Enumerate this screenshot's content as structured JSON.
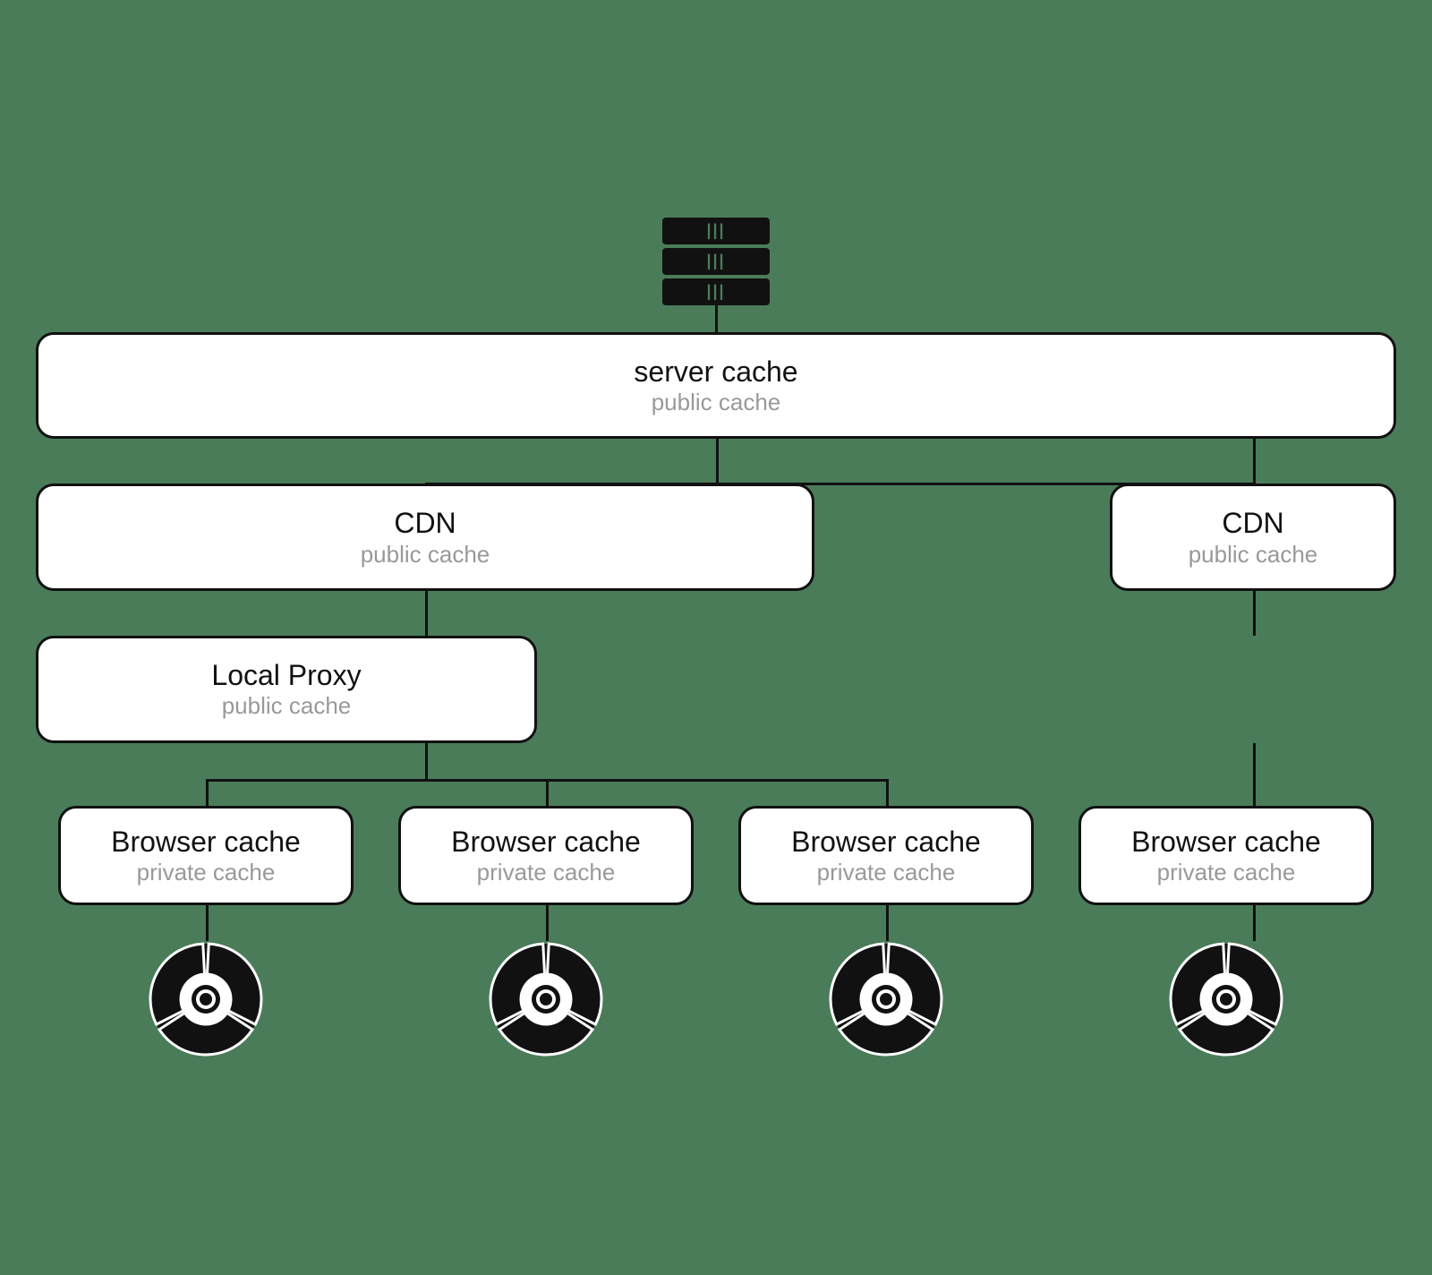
{
  "diagram": {
    "server": {
      "label": "server cache",
      "sublabel": "public cache"
    },
    "cdn_left": {
      "label": "CDN",
      "sublabel": "public cache"
    },
    "cdn_right": {
      "label": "CDN",
      "sublabel": "public cache"
    },
    "local_proxy": {
      "label": "Local Proxy",
      "sublabel": "public cache"
    },
    "browser_caches": [
      {
        "label": "Browser cache",
        "sublabel": "private cache"
      },
      {
        "label": "Browser cache",
        "sublabel": "private cache"
      },
      {
        "label": "Browser cache",
        "sublabel": "private cache"
      },
      {
        "label": "Browser cache",
        "sublabel": "private cache"
      }
    ]
  }
}
